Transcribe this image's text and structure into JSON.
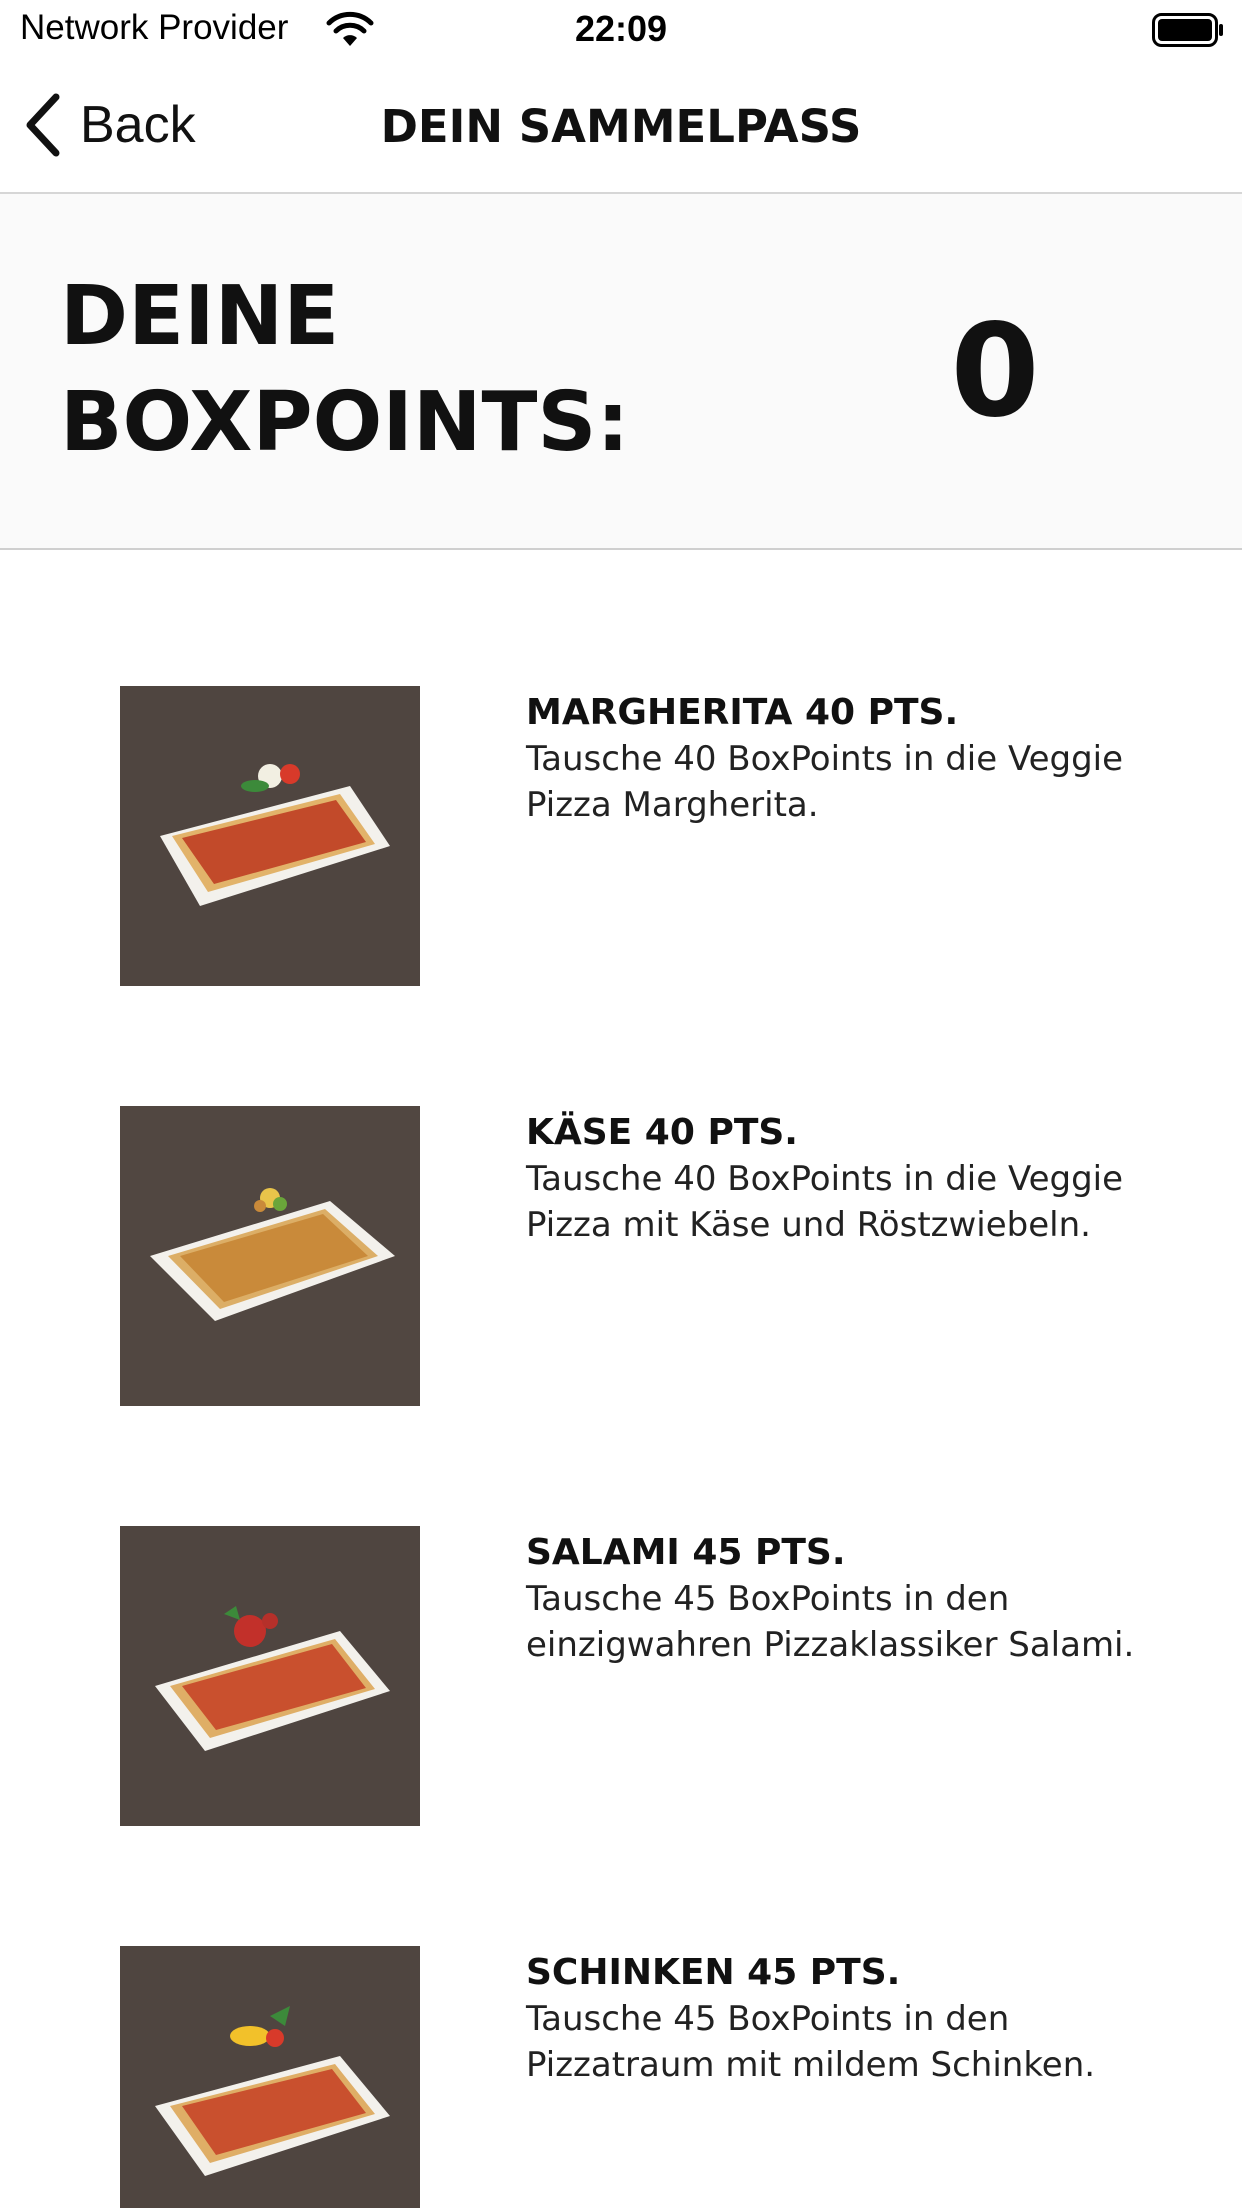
{
  "status_bar": {
    "carrier": "Network Provider",
    "time": "22:09"
  },
  "nav": {
    "back_label": "Back",
    "title": "DEIN SAMMELPASS"
  },
  "points": {
    "label_line1": "DEINE",
    "label_line2": "BOXPOINTS:",
    "value": "0"
  },
  "rewards": [
    {
      "title": "MARGHERITA 40 PTS.",
      "description": "Tausche 40 BoxPoints in die Veggie Pizza Margherita.",
      "topping_colors": [
        "#f2efe2",
        "#d83a2a",
        "#3c8a3a"
      ]
    },
    {
      "title": "KÄSE 40 PTS.",
      "description": "Tausche 40 BoxPoints in die Veggie Pizza mit Käse und Röstzwiebeln.",
      "topping_colors": [
        "#e8c44a",
        "#6aa53a",
        "#c98a3a"
      ]
    },
    {
      "title": "SALAMI 45 PTS.",
      "description": "Tausche 45 BoxPoints in den einzigwahren Pizzaklassiker Salami.",
      "topping_colors": [
        "#c2302a",
        "#3c8a3a",
        "#b5302a"
      ]
    },
    {
      "title": "SCHINKEN 45 PTS.",
      "description": "Tausche 45 BoxPoints in den Pizzatraum mit mildem Schinken.",
      "topping_colors": [
        "#f2c12a",
        "#d83a2a",
        "#3c8a3a"
      ]
    }
  ]
}
